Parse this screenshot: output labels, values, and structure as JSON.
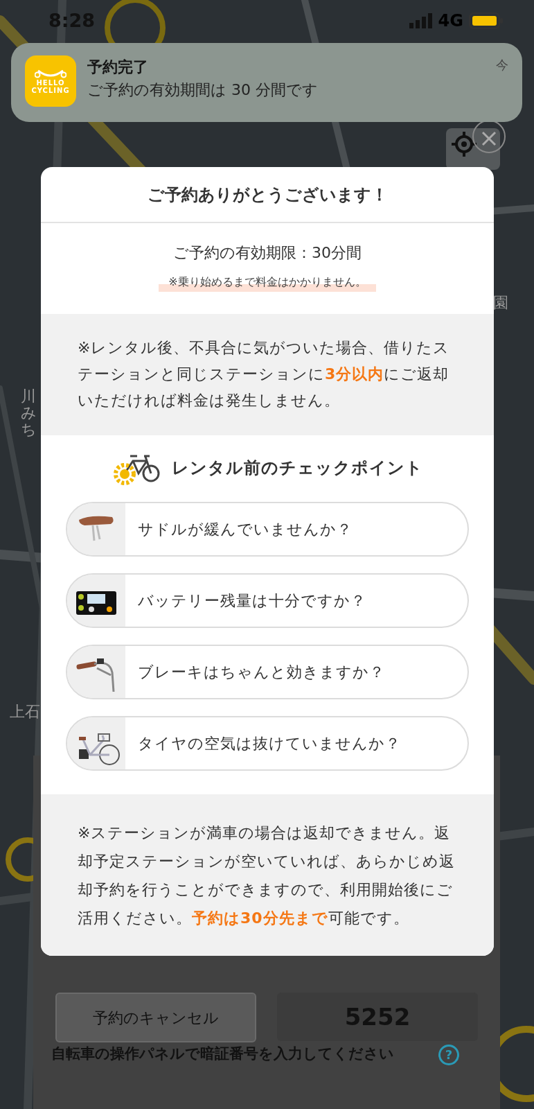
{
  "status_bar": {
    "time": "8:28",
    "network": "4G"
  },
  "notification": {
    "app_label_lines": [
      "HELLO",
      "CYCLING"
    ],
    "title": "予約完了",
    "body": "ご予約の有効期間は 30 分間です",
    "time": "今"
  },
  "map_labels": [
    {
      "text": "園"
    },
    {
      "text": "川みち"
    },
    {
      "text": "上石"
    }
  ],
  "modal": {
    "title": "ご予約ありがとうございます！",
    "expiry": "ご予約の有効期限：30分間",
    "expiry_note": "※乗り始めるまで料金はかかりません。",
    "notice": [
      {
        "text": "※レンタル後、不具合に気がついた場合、借りたステーションと同じステーションに",
        "highlight": false
      },
      {
        "text": "3分以内",
        "highlight": true
      },
      {
        "text": "にご返却いただければ料金は発生しません。",
        "highlight": false
      }
    ],
    "checkpoints_title": "レンタル前のチェックポイント",
    "checkpoints": [
      {
        "kind": "saddle",
        "label": "サドルが緩んでいませんか？"
      },
      {
        "kind": "battery",
        "label": "バッテリー残量は十分ですか？"
      },
      {
        "kind": "brake",
        "label": "ブレーキはちゃんと効きますか？"
      },
      {
        "kind": "tire",
        "label": "タイヤの空気は抜けていませんか？"
      }
    ],
    "footer_note": [
      {
        "text": "※ステーションが満車の場合は返却できません。返却予定ステーションが空いていれば、あらかじめ返却予約を行うことができますので、利用開始後にご活用ください。",
        "highlight": false
      },
      {
        "text": "予約は30分先まで",
        "highlight": true
      },
      {
        "text": "可能です。",
        "highlight": false
      }
    ]
  },
  "bottom_panel": {
    "cancel_button": "予約のキャンセル",
    "pin_code": "5252",
    "instruction": "自転車の操作パネルで暗証番号を入力してください",
    "help_icon": "?"
  }
}
